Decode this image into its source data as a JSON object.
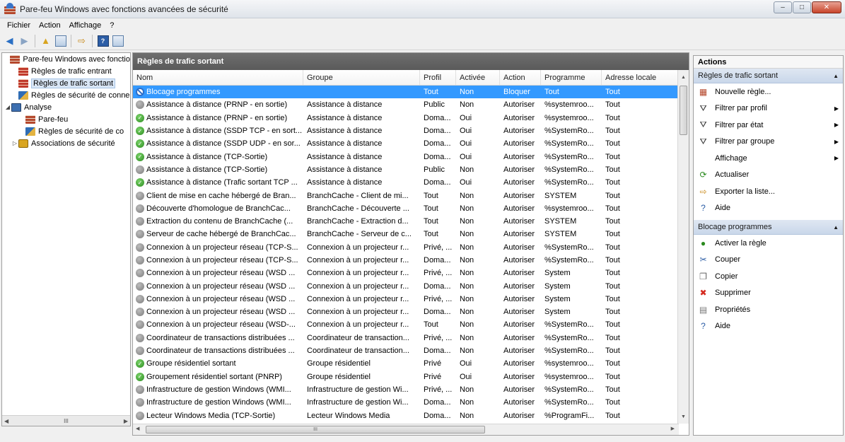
{
  "window": {
    "title": "Pare-feu Windows avec fonctions avancées de sécurité",
    "minimize": "–",
    "maximize": "□",
    "close": "✕"
  },
  "menu": [
    "Fichier",
    "Action",
    "Affichage",
    "?"
  ],
  "tree": {
    "items": [
      {
        "label": "Pare-feu Windows avec fonctio",
        "icon": "firewall-icon",
        "level": 0,
        "exp": ""
      },
      {
        "label": "Règles de trafic entrant",
        "icon": "inbound-rules-icon",
        "level": 1,
        "exp": ""
      },
      {
        "label": "Règles de trafic sortant",
        "icon": "outbound-rules-icon",
        "level": 1,
        "exp": "",
        "selected": true
      },
      {
        "label": "Règles de sécurité de conne",
        "icon": "connection-security-icon",
        "level": 1,
        "exp": ""
      },
      {
        "label": "Analyse",
        "icon": "monitoring-icon",
        "level": 0,
        "exp": "◢"
      },
      {
        "label": "Pare-feu",
        "icon": "firewall-icon",
        "level": 2,
        "exp": ""
      },
      {
        "label": "Règles de sécurité de co",
        "icon": "connection-security-icon",
        "level": 2,
        "exp": ""
      },
      {
        "label": "Associations de sécurité",
        "icon": "lock-icon",
        "level": 1,
        "exp": "▷"
      }
    ],
    "hscroll_label": "III"
  },
  "center": {
    "title": "Règles de trafic sortant",
    "columns": [
      "Nom",
      "Groupe",
      "Profil",
      "Activée",
      "Action",
      "Programme",
      "Adresse locale"
    ],
    "rows": [
      {
        "icon": "block",
        "nom": "Blocage programmes",
        "groupe": "",
        "profil": "Tout",
        "activee": "Non",
        "action": "Bloquer",
        "programme": "Tout",
        "adresse": "Tout",
        "selected": true
      },
      {
        "icon": "off",
        "nom": "Assistance à distance (PRNP - en sortie)",
        "groupe": "Assistance à distance",
        "profil": "Public",
        "activee": "Non",
        "action": "Autoriser",
        "programme": "%systemroo...",
        "adresse": "Tout"
      },
      {
        "icon": "allow",
        "nom": "Assistance à distance (PRNP - en sortie)",
        "groupe": "Assistance à distance",
        "profil": "Doma...",
        "activee": "Oui",
        "action": "Autoriser",
        "programme": "%systemroo...",
        "adresse": "Tout"
      },
      {
        "icon": "allow",
        "nom": "Assistance à distance (SSDP TCP - en sort...",
        "groupe": "Assistance à distance",
        "profil": "Doma...",
        "activee": "Oui",
        "action": "Autoriser",
        "programme": "%SystemRo...",
        "adresse": "Tout"
      },
      {
        "icon": "allow",
        "nom": "Assistance à distance (SSDP UDP - en sor...",
        "groupe": "Assistance à distance",
        "profil": "Doma...",
        "activee": "Oui",
        "action": "Autoriser",
        "programme": "%SystemRo...",
        "adresse": "Tout"
      },
      {
        "icon": "allow",
        "nom": "Assistance à distance (TCP-Sortie)",
        "groupe": "Assistance à distance",
        "profil": "Doma...",
        "activee": "Oui",
        "action": "Autoriser",
        "programme": "%SystemRo...",
        "adresse": "Tout"
      },
      {
        "icon": "off",
        "nom": "Assistance à distance (TCP-Sortie)",
        "groupe": "Assistance à distance",
        "profil": "Public",
        "activee": "Non",
        "action": "Autoriser",
        "programme": "%SystemRo...",
        "adresse": "Tout"
      },
      {
        "icon": "allow",
        "nom": "Assistance à distance (Trafic sortant TCP ...",
        "groupe": "Assistance à distance",
        "profil": "Doma...",
        "activee": "Oui",
        "action": "Autoriser",
        "programme": "%SystemRo...",
        "adresse": "Tout"
      },
      {
        "icon": "off",
        "nom": "Client de mise en cache hébergé de Bran...",
        "groupe": "BranchCache - Client de mi...",
        "profil": "Tout",
        "activee": "Non",
        "action": "Autoriser",
        "programme": "SYSTEM",
        "adresse": "Tout"
      },
      {
        "icon": "off",
        "nom": "Découverte d'homologue de BranchCac...",
        "groupe": "BranchCache - Découverte ...",
        "profil": "Tout",
        "activee": "Non",
        "action": "Autoriser",
        "programme": "%systemroo...",
        "adresse": "Tout"
      },
      {
        "icon": "off",
        "nom": "Extraction du contenu de BranchCache (...",
        "groupe": "BranchCache - Extraction d...",
        "profil": "Tout",
        "activee": "Non",
        "action": "Autoriser",
        "programme": "SYSTEM",
        "adresse": "Tout"
      },
      {
        "icon": "off",
        "nom": "Serveur de cache hébergé de BranchCac...",
        "groupe": "BranchCache - Serveur de c...",
        "profil": "Tout",
        "activee": "Non",
        "action": "Autoriser",
        "programme": "SYSTEM",
        "adresse": "Tout"
      },
      {
        "icon": "off",
        "nom": "Connexion à un projecteur réseau (TCP-S...",
        "groupe": "Connexion à un projecteur r...",
        "profil": "Privé, ...",
        "activee": "Non",
        "action": "Autoriser",
        "programme": "%SystemRo...",
        "adresse": "Tout"
      },
      {
        "icon": "off",
        "nom": "Connexion à un projecteur réseau (TCP-S...",
        "groupe": "Connexion à un projecteur r...",
        "profil": "Doma...",
        "activee": "Non",
        "action": "Autoriser",
        "programme": "%SystemRo...",
        "adresse": "Tout"
      },
      {
        "icon": "off",
        "nom": "Connexion à un projecteur réseau (WSD ...",
        "groupe": "Connexion à un projecteur r...",
        "profil": "Privé, ...",
        "activee": "Non",
        "action": "Autoriser",
        "programme": "System",
        "adresse": "Tout"
      },
      {
        "icon": "off",
        "nom": "Connexion à un projecteur réseau (WSD ...",
        "groupe": "Connexion à un projecteur r...",
        "profil": "Doma...",
        "activee": "Non",
        "action": "Autoriser",
        "programme": "System",
        "adresse": "Tout"
      },
      {
        "icon": "off",
        "nom": "Connexion à un projecteur réseau (WSD ...",
        "groupe": "Connexion à un projecteur r...",
        "profil": "Privé, ...",
        "activee": "Non",
        "action": "Autoriser",
        "programme": "System",
        "adresse": "Tout"
      },
      {
        "icon": "off",
        "nom": "Connexion à un projecteur réseau (WSD ...",
        "groupe": "Connexion à un projecteur r...",
        "profil": "Doma...",
        "activee": "Non",
        "action": "Autoriser",
        "programme": "System",
        "adresse": "Tout"
      },
      {
        "icon": "off",
        "nom": "Connexion à un projecteur réseau (WSD-...",
        "groupe": "Connexion à un projecteur r...",
        "profil": "Tout",
        "activee": "Non",
        "action": "Autoriser",
        "programme": "%SystemRo...",
        "adresse": "Tout"
      },
      {
        "icon": "off",
        "nom": "Coordinateur de transactions distribuées ...",
        "groupe": "Coordinateur de transaction...",
        "profil": "Privé, ...",
        "activee": "Non",
        "action": "Autoriser",
        "programme": "%SystemRo...",
        "adresse": "Tout"
      },
      {
        "icon": "off",
        "nom": "Coordinateur de transactions distribuées ...",
        "groupe": "Coordinateur de transaction...",
        "profil": "Doma...",
        "activee": "Non",
        "action": "Autoriser",
        "programme": "%SystemRo...",
        "adresse": "Tout"
      },
      {
        "icon": "allow",
        "nom": "Groupe résidentiel sortant",
        "groupe": "Groupe résidentiel",
        "profil": "Privé",
        "activee": "Oui",
        "action": "Autoriser",
        "programme": "%systemroo...",
        "adresse": "Tout"
      },
      {
        "icon": "allow",
        "nom": "Groupement résidentiel sortant (PNRP)",
        "groupe": "Groupe résidentiel",
        "profil": "Privé",
        "activee": "Oui",
        "action": "Autoriser",
        "programme": "%systemroo...",
        "adresse": "Tout"
      },
      {
        "icon": "off",
        "nom": "Infrastructure de gestion Windows (WMI...",
        "groupe": "Infrastructure de gestion Wi...",
        "profil": "Privé, ...",
        "activee": "Non",
        "action": "Autoriser",
        "programme": "%SystemRo...",
        "adresse": "Tout"
      },
      {
        "icon": "off",
        "nom": "Infrastructure de gestion Windows (WMI...",
        "groupe": "Infrastructure de gestion Wi...",
        "profil": "Doma...",
        "activee": "Non",
        "action": "Autoriser",
        "programme": "%SystemRo...",
        "adresse": "Tout"
      },
      {
        "icon": "off",
        "nom": "Lecteur Windows Media (TCP-Sortie)",
        "groupe": "Lecteur Windows Media",
        "profil": "Doma...",
        "activee": "Non",
        "action": "Autoriser",
        "programme": "%ProgramFi...",
        "adresse": "Tout"
      }
    ],
    "hscroll_label": "III"
  },
  "actions": {
    "title": "Actions",
    "sections": [
      {
        "title": "Règles de trafic sortant",
        "items": [
          {
            "label": "Nouvelle règle...",
            "icon": "new-rule-icon",
            "glyph": "▦",
            "color": "#b5482d",
            "arrow": false
          },
          {
            "label": "Filtrer par profil",
            "icon": "filter-icon",
            "glyph": "⛛",
            "color": "#333333",
            "arrow": true
          },
          {
            "label": "Filtrer par état",
            "icon": "filter-icon",
            "glyph": "⛛",
            "color": "#333333",
            "arrow": true
          },
          {
            "label": "Filtrer par groupe",
            "icon": "filter-icon",
            "glyph": "⛛",
            "color": "#333333",
            "arrow": true
          },
          {
            "label": "Affichage",
            "icon": "",
            "glyph": "",
            "color": "",
            "arrow": true
          },
          {
            "label": "Actualiser",
            "icon": "refresh-icon",
            "glyph": "⟳",
            "color": "#2a8a1e",
            "arrow": false
          },
          {
            "label": "Exporter la liste...",
            "icon": "export-icon",
            "glyph": "⇨",
            "color": "#c98a1a",
            "arrow": false
          },
          {
            "label": "Aide",
            "icon": "help-icon",
            "glyph": "?",
            "color": "#2d5ea6",
            "arrow": false
          }
        ]
      },
      {
        "title": "Blocage programmes",
        "items": [
          {
            "label": "Activer la règle",
            "icon": "enable-rule-icon",
            "glyph": "●",
            "color": "#2a8a1e",
            "arrow": false
          },
          {
            "label": "Couper",
            "icon": "cut-icon",
            "glyph": "✂",
            "color": "#2d5ea6",
            "arrow": false
          },
          {
            "label": "Copier",
            "icon": "copy-icon",
            "glyph": "❐",
            "color": "#666666",
            "arrow": false
          },
          {
            "label": "Supprimer",
            "icon": "delete-icon",
            "glyph": "✖",
            "color": "#d42a1f",
            "arrow": false
          },
          {
            "label": "Propriétés",
            "icon": "properties-icon",
            "glyph": "▤",
            "color": "#777777",
            "arrow": false
          },
          {
            "label": "Aide",
            "icon": "help-icon",
            "glyph": "?",
            "color": "#2d5ea6",
            "arrow": false
          }
        ]
      }
    ]
  }
}
